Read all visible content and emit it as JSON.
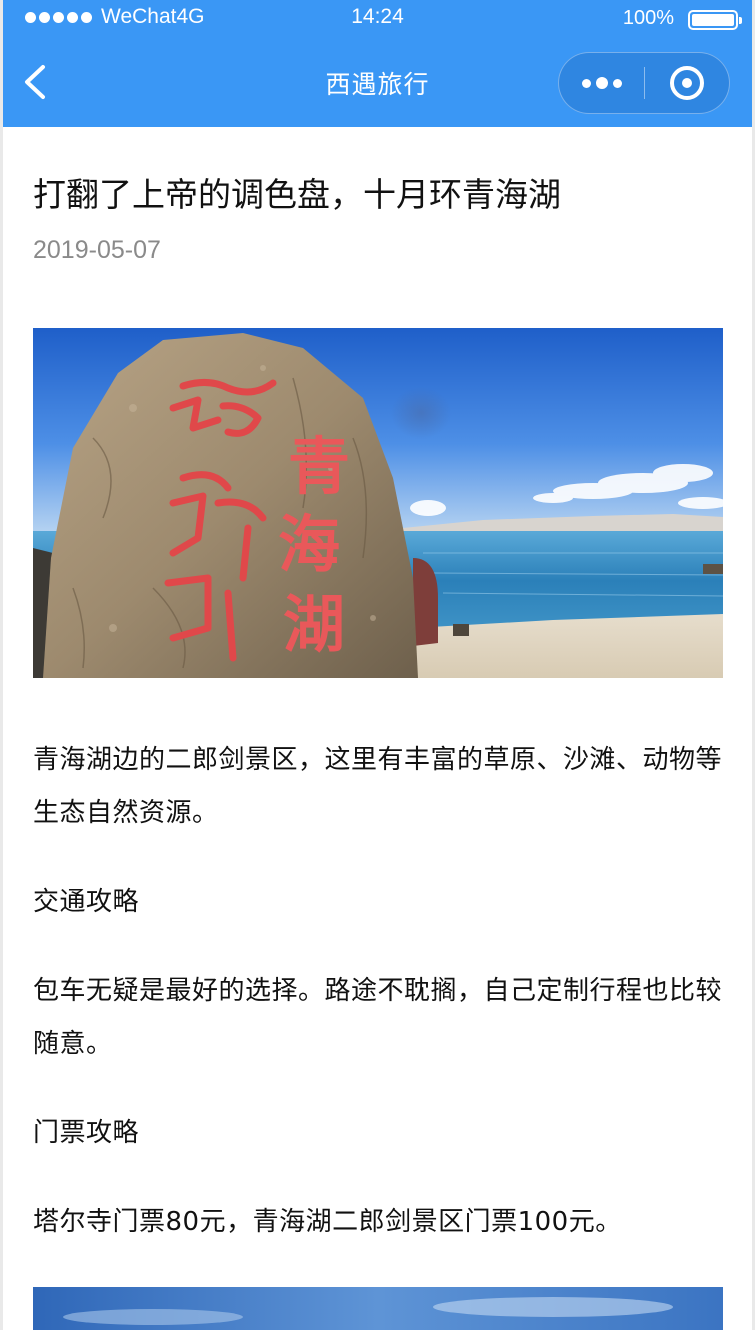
{
  "status_bar": {
    "carrier": "WeChat4G",
    "time": "14:24",
    "battery": "100%"
  },
  "nav": {
    "title": "西遇旅行",
    "back_icon": "chevron-left-icon",
    "more_icon": "more-dots-icon",
    "close_icon": "target-ring-icon"
  },
  "article": {
    "title": "打翻了上帝的调色盘，十月环青海湖",
    "date": "2019-05-07",
    "hero_image": {
      "stone_text": "青海湖",
      "subject": "engraved stone by the lake"
    },
    "paragraphs": [
      "青海湖边的二郎剑景区，这里有丰富的草原、沙滩、动物等生态自然资源。",
      "交通攻略",
      "包车无疑是最好的选择。路途不耽搁，自己定制行程也比较随意。",
      "门票攻略",
      "塔尔寺门票80元，青海湖二郎剑景区门票100元。"
    ]
  },
  "colors": {
    "nav_background": "#3a97f5",
    "date_text": "#8a8a8a",
    "body_text": "#111111"
  }
}
